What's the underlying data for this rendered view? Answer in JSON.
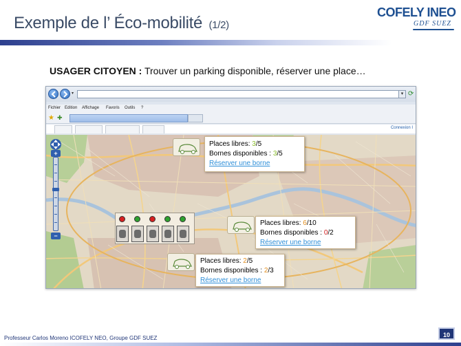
{
  "slide": {
    "title": "Exemple de l’ Éco-mobilité",
    "title_suffix": "(1/2)",
    "subtitle_bold": "USAGER CITOYEN :",
    "subtitle_rest": " Trouver un parking disponible, réserver une place…",
    "footer": "Professeur Carlos Moreno ICOFELY NEO, Groupe GDF SUEZ",
    "page_number": "10"
  },
  "logo": {
    "brand": "COFELY INEO",
    "group": "GDF SUEZ"
  },
  "browser": {
    "menu": [
      "Fichier",
      "Edition",
      "Affichage",
      "Favoris",
      "Outils",
      "?"
    ],
    "connexion_label": "Connexion I"
  },
  "popups": [
    {
      "places_label": "Places libres: ",
      "places_free": "3",
      "places_total": "/5",
      "bornes_label": "Bornes disponibles : ",
      "bornes_free": "3",
      "bornes_total": "/5",
      "link": "Réserver une borne",
      "status": "green"
    },
    {
      "places_label": "Places libres: ",
      "places_free": "6",
      "places_total": "/10",
      "bornes_label": "Bornes disponibles : ",
      "bornes_free": "0",
      "bornes_total": "/2",
      "link": "Réserver une borne",
      "status": "mixed"
    },
    {
      "places_label": "Places libres: ",
      "places_free": "2",
      "places_total": "/5",
      "bornes_label": "Bornes disponibles : ",
      "bornes_free": "2",
      "bornes_total": "/3",
      "link": "Réserver une borne",
      "status": "mixed"
    }
  ],
  "colors": {
    "title": "#3a4b66",
    "brand_blue": "#1d4f91",
    "link": "#2f8fd8",
    "available": "#8bbf2b",
    "partial": "#e38f1f",
    "none": "#d11a1a"
  },
  "parking_lights": [
    "red",
    "green",
    "red",
    "green",
    "green"
  ]
}
